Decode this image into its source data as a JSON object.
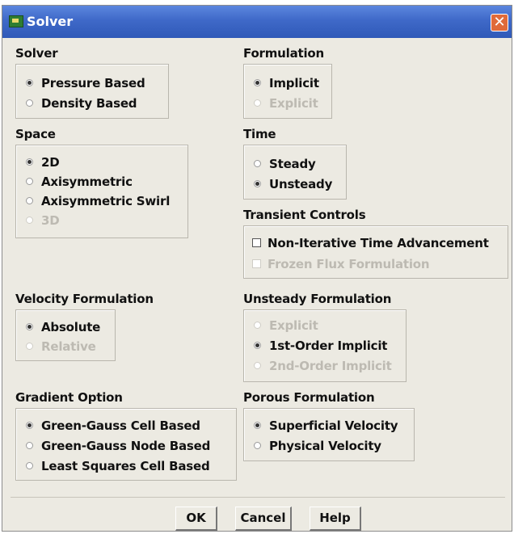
{
  "window": {
    "title": "Solver",
    "close_glyph": "✕"
  },
  "solver": {
    "label": "Solver",
    "options": [
      {
        "label": "Pressure Based",
        "selected": true,
        "enabled": true
      },
      {
        "label": "Density Based",
        "selected": false,
        "enabled": true
      }
    ]
  },
  "formulation": {
    "label": "Formulation",
    "options": [
      {
        "label": "Implicit",
        "selected": true,
        "enabled": true
      },
      {
        "label": "Explicit",
        "selected": false,
        "enabled": false
      }
    ]
  },
  "space": {
    "label": "Space",
    "options": [
      {
        "label": "2D",
        "selected": true,
        "enabled": true
      },
      {
        "label": "Axisymmetric",
        "selected": false,
        "enabled": true
      },
      {
        "label": "Axisymmetric Swirl",
        "selected": false,
        "enabled": true
      },
      {
        "label": "3D",
        "selected": false,
        "enabled": false
      }
    ]
  },
  "time": {
    "label": "Time",
    "options": [
      {
        "label": "Steady",
        "selected": false,
        "enabled": true
      },
      {
        "label": "Unsteady",
        "selected": true,
        "enabled": true
      }
    ]
  },
  "transient_controls": {
    "label": "Transient Controls",
    "options": [
      {
        "label": "Non-Iterative Time Advancement",
        "checked": false,
        "enabled": true
      },
      {
        "label": "Frozen Flux Formulation",
        "checked": false,
        "enabled": false
      }
    ]
  },
  "velocity_formulation": {
    "label": "Velocity Formulation",
    "options": [
      {
        "label": "Absolute",
        "selected": true,
        "enabled": true
      },
      {
        "label": "Relative",
        "selected": false,
        "enabled": false
      }
    ]
  },
  "unsteady_formulation": {
    "label": "Unsteady Formulation",
    "options": [
      {
        "label": "Explicit",
        "selected": false,
        "enabled": false
      },
      {
        "label": "1st-Order Implicit",
        "selected": true,
        "enabled": true
      },
      {
        "label": "2nd-Order Implicit",
        "selected": false,
        "enabled": false
      }
    ]
  },
  "gradient_option": {
    "label": "Gradient Option",
    "options": [
      {
        "label": "Green-Gauss Cell Based",
        "selected": true,
        "enabled": true
      },
      {
        "label": "Green-Gauss Node Based",
        "selected": false,
        "enabled": true
      },
      {
        "label": "Least Squares Cell Based",
        "selected": false,
        "enabled": true
      }
    ]
  },
  "porous_formulation": {
    "label": "Porous Formulation",
    "options": [
      {
        "label": "Superficial Velocity",
        "selected": true,
        "enabled": true
      },
      {
        "label": "Physical Velocity",
        "selected": false,
        "enabled": true
      }
    ]
  },
  "buttons": {
    "ok": "OK",
    "cancel": "Cancel",
    "help": "Help"
  }
}
